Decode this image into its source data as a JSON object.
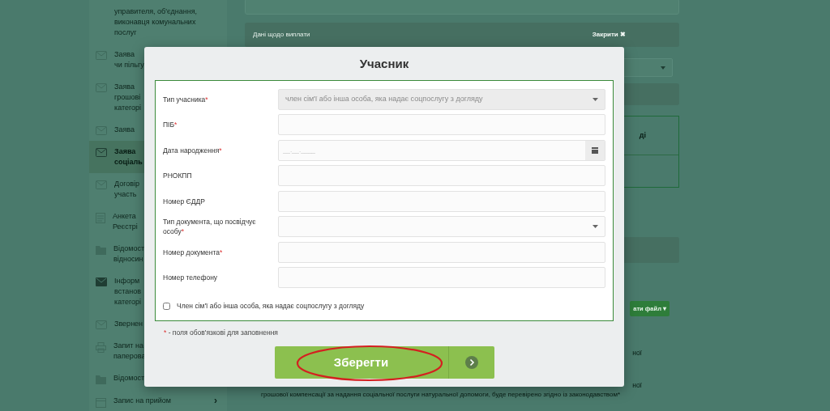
{
  "sidebar": {
    "items": [
      {
        "selected": false,
        "lines": [
          "управителя, об'єднання,",
          "виконавця комунальних",
          "послуг"
        ]
      },
      {
        "selected": false,
        "lines": [
          "Заява",
          "чи пільгу"
        ]
      },
      {
        "selected": false,
        "lines": [
          "Заява",
          "грошові",
          "категорі"
        ]
      },
      {
        "selected": false,
        "lines": [
          "Заява"
        ]
      },
      {
        "selected": true,
        "lines": [
          "Заява",
          "соціаль"
        ]
      },
      {
        "selected": false,
        "lines": [
          "Договір",
          "участь"
        ]
      },
      {
        "selected": false,
        "lines": [
          "Анкета",
          "Реєстрі"
        ]
      },
      {
        "selected": false,
        "lines": [
          "Відомост",
          "відносин"
        ]
      },
      {
        "selected": false,
        "lines": [
          "Інформ",
          "встанов",
          "категорі"
        ]
      },
      {
        "selected": false,
        "lines": [
          "Звернен"
        ]
      },
      {
        "selected": false,
        "lines": [
          "Запит на",
          "паперова"
        ]
      },
      {
        "selected": false,
        "lines": [
          "Відомост"
        ]
      },
      {
        "selected": false,
        "lines": [
          "Запис на прийом"
        ],
        "chevron": "›"
      }
    ]
  },
  "background": {
    "payment_header": "Дані щодо виплати",
    "close_link": "Закрити ✖",
    "box_fragment": "ді",
    "file_button": "ати файл ▾",
    "fragment_1": "ної",
    "fragment_2": "ної",
    "bottom_line": "грошової компенсації за надання соціальної послуги натуральної допомоги, буде перевірено згідно із законодавством*"
  },
  "modal": {
    "title": "Учасник",
    "fields": [
      {
        "kind": "select",
        "label": "Тип учасника",
        "mark": "*",
        "value": "член сім'ї або інша особа, яка надає соцпослугу з догляду",
        "disabled": true
      },
      {
        "kind": "text",
        "label": "ПІБ",
        "mark": "*"
      },
      {
        "kind": "date",
        "label": "Дата народження",
        "mark": "*",
        "placeholder": "__.__.____"
      },
      {
        "kind": "text",
        "label": "РНОКПП"
      },
      {
        "kind": "text",
        "label": "Номер ЄДДР"
      },
      {
        "kind": "select",
        "label": "Тип документа, що посвідчує особу",
        "mark": "*",
        "disabled": false
      },
      {
        "kind": "text",
        "label": "Номер документа",
        "mark": "*"
      },
      {
        "kind": "text",
        "label": "Номер телефону"
      }
    ],
    "checkbox": {
      "label": "Член сім'ї або інша особа, яка надає соцпослугу з догляду",
      "checked": false
    },
    "note": {
      "mark": "*",
      "text": " - поля обов'язкові для заповнення"
    },
    "save_button": "Зберегти"
  }
}
